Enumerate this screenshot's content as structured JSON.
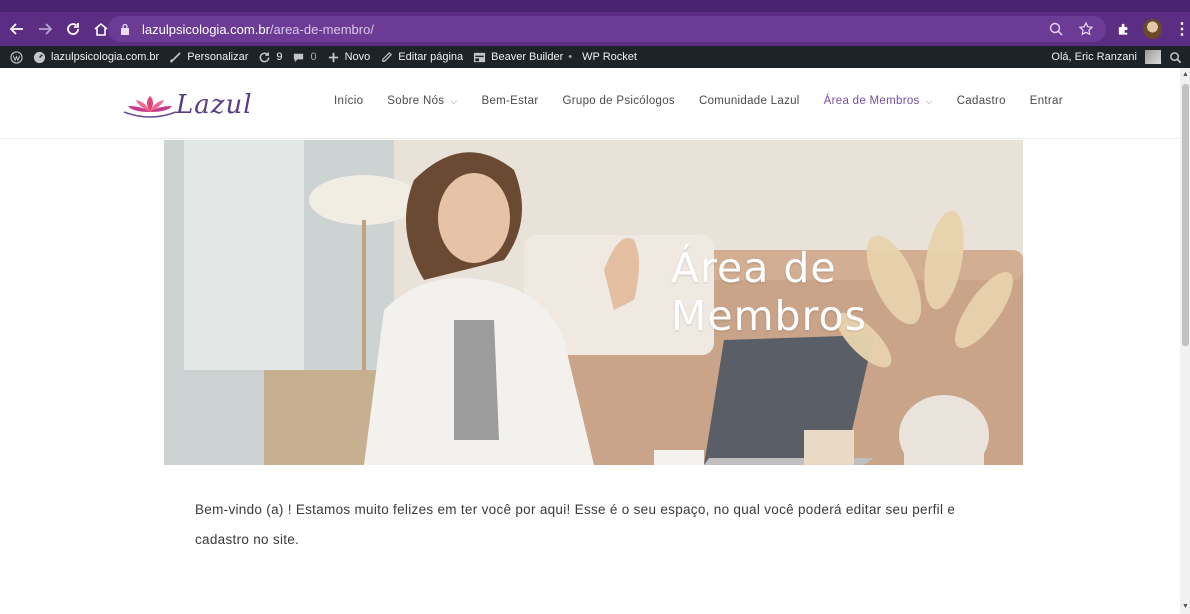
{
  "browser": {
    "url_host": "lazulpsicologia.com.br",
    "url_path": "/area-de-membro/",
    "icons": [
      "back-arrow-icon",
      "forward-arrow-icon",
      "reload-icon",
      "home-icon",
      "lock-icon",
      "zoom-icon",
      "star-icon",
      "extensions-puzzle-icon",
      "profile-avatar",
      "kebab-menu-icon"
    ]
  },
  "admin_bar": {
    "site_name": "lazulpsicologia.com.br",
    "customize": "Personalizar",
    "updates_count": "9",
    "comments_count": "0",
    "new": "Novo",
    "edit_page": "Editar página",
    "beaver_builder": "Beaver Builder",
    "wp_rocket": "WP Rocket",
    "greeting": "Olá, Eric Ranzani"
  },
  "site": {
    "logo_text": "Lazul",
    "nav": [
      {
        "label": "Início"
      },
      {
        "label": "Sobre Nós"
      },
      {
        "label": "Bem-Estar"
      },
      {
        "label": "Grupo de Psicólogos"
      },
      {
        "label": "Comunidade Lazul"
      },
      {
        "label": "Área de Membros"
      },
      {
        "label": "Cadastro"
      },
      {
        "label": "Entrar"
      }
    ]
  },
  "hero": {
    "title": "Área de Membros"
  },
  "content": {
    "welcome_text": "Bem-vindo (a) ! Estamos muito felizes em ter você por aqui! Esse é o seu espaço, no qual você poderá editar seu perfil e cadastro no site."
  },
  "colors": {
    "browser_purple": "#5b2d83",
    "admin_bar": "#1d2327",
    "brand_purple": "#7b4ea3"
  }
}
